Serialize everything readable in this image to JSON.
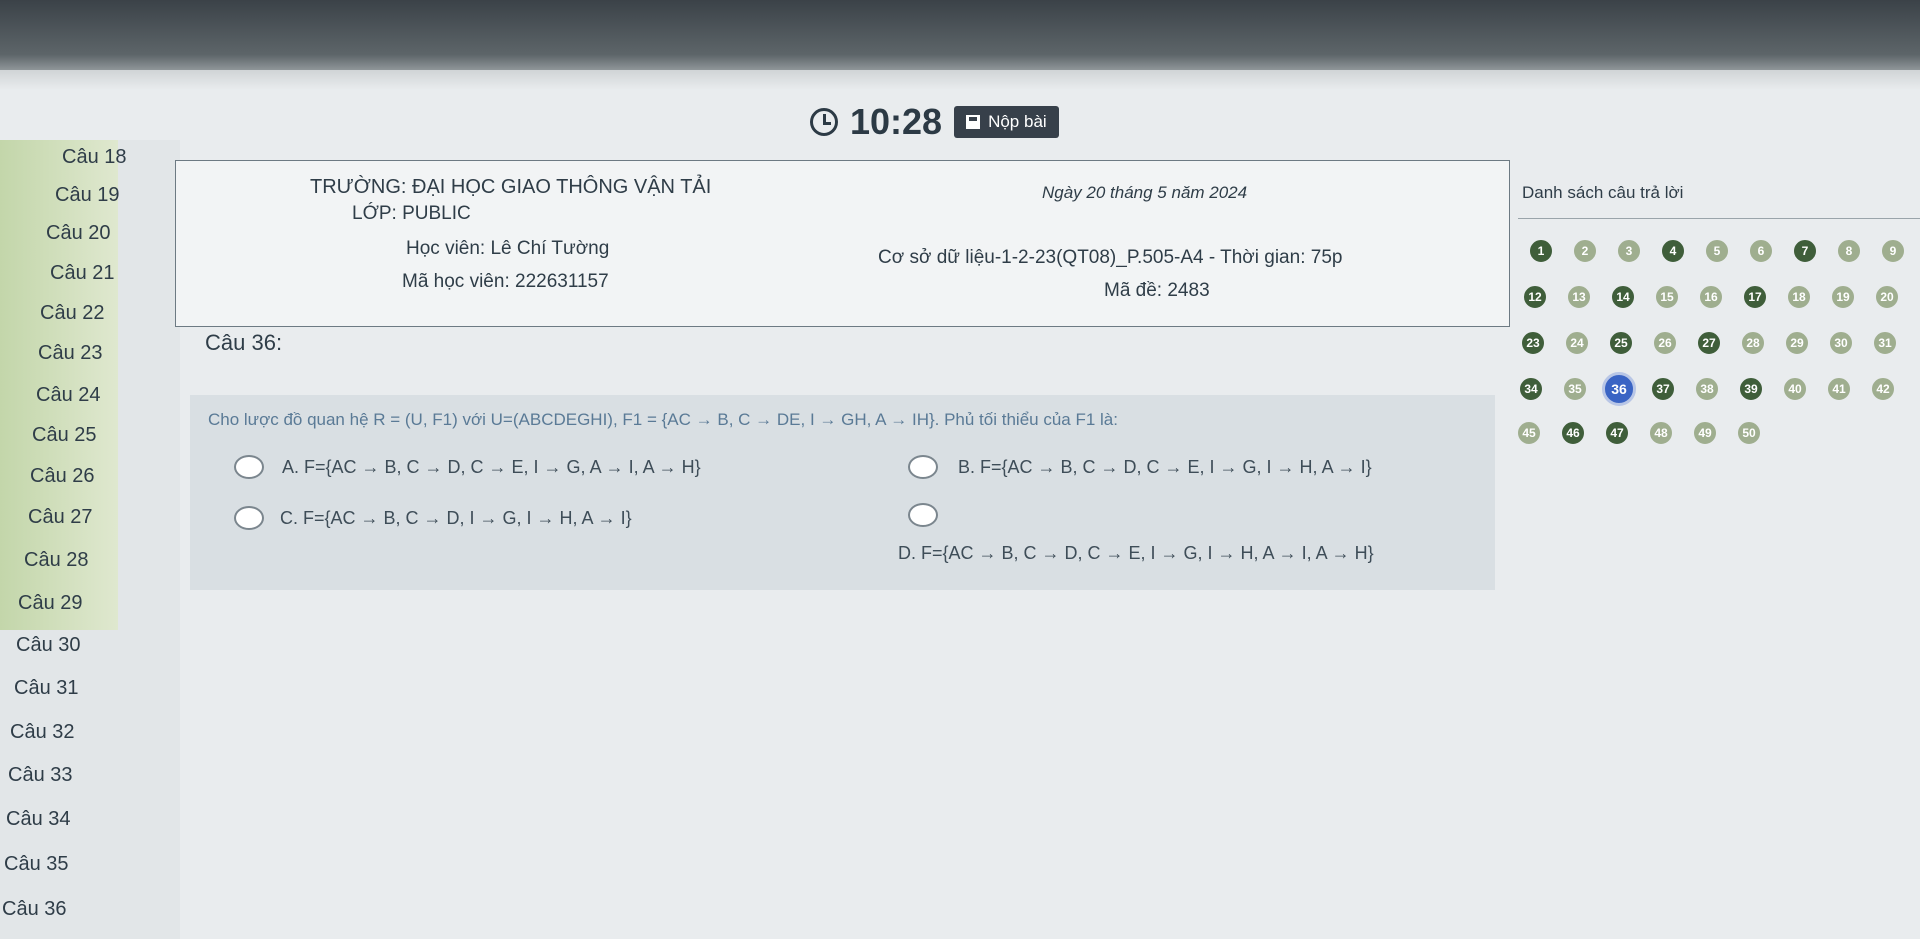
{
  "timer": {
    "time": "10:28",
    "submit_label": "Nộp bài"
  },
  "sidebar": {
    "items": [
      "Câu 18",
      "Câu 19",
      "Câu 20",
      "Câu 21",
      "Câu 22",
      "Câu 23",
      "Câu 24",
      "Câu 25",
      "Câu 26",
      "Câu 27",
      "Câu 28",
      "Câu 29",
      "Câu 30",
      "Câu 31",
      "Câu 32",
      "Câu 33",
      "Câu 34",
      "Câu 35",
      "Câu 36"
    ]
  },
  "exam_info": {
    "school": "TRƯỜNG: ĐẠI HỌC GIAO THÔNG VẬN TẢI",
    "class": "LỚP: PUBLIC",
    "student": "Học viên: Lê Chí Tường",
    "student_id": "Mã học viên: 222631157",
    "date": "Ngày 20 tháng 5 năm 2024",
    "subject": "Cơ sở dữ liệu-1-2-23(QT08)_P.505-A4 - Thời gian: 75p",
    "exam_code": "Mã đề: 2483"
  },
  "question": {
    "title": "Câu 36:",
    "text": "Cho lược đồ quan hệ R = (U, F1) với U=(ABCDEGHI), F1 = {AC → B, C → DE, I → GH, A → IH}. Phủ tối thiểu của F1 là:",
    "options": {
      "a": "A. F={AC → B, C → D, C → E, I → G, A → I, A → H}",
      "b": "B. F={AC → B, C → D, C → E, I → G, I → H, A → I}",
      "c": "C. F={AC → B, C → D, I → G, I → H, A → I}",
      "d": "D. F={AC → B, C → D, C → E, I → G, I → H, A → I, A → H}"
    }
  },
  "answers": {
    "title": "Danh sách câu trả lời",
    "rows": [
      [
        "1",
        "2",
        "3",
        "4",
        "5",
        "6",
        "7",
        "8",
        "9"
      ],
      [
        "12",
        "13",
        "14",
        "15",
        "16",
        "17",
        "18",
        "19",
        "20"
      ],
      [
        "23",
        "24",
        "25",
        "26",
        "27",
        "28",
        "29",
        "30",
        "31"
      ],
      [
        "34",
        "35",
        "36",
        "37",
        "38",
        "39",
        "40",
        "41",
        "42"
      ],
      [
        "45",
        "46",
        "47",
        "48",
        "49",
        "50"
      ]
    ],
    "current": "36",
    "answered_color": "#3f5e3a",
    "unanswered_color": "#9fae8f",
    "current_color": "#3a64c4"
  }
}
